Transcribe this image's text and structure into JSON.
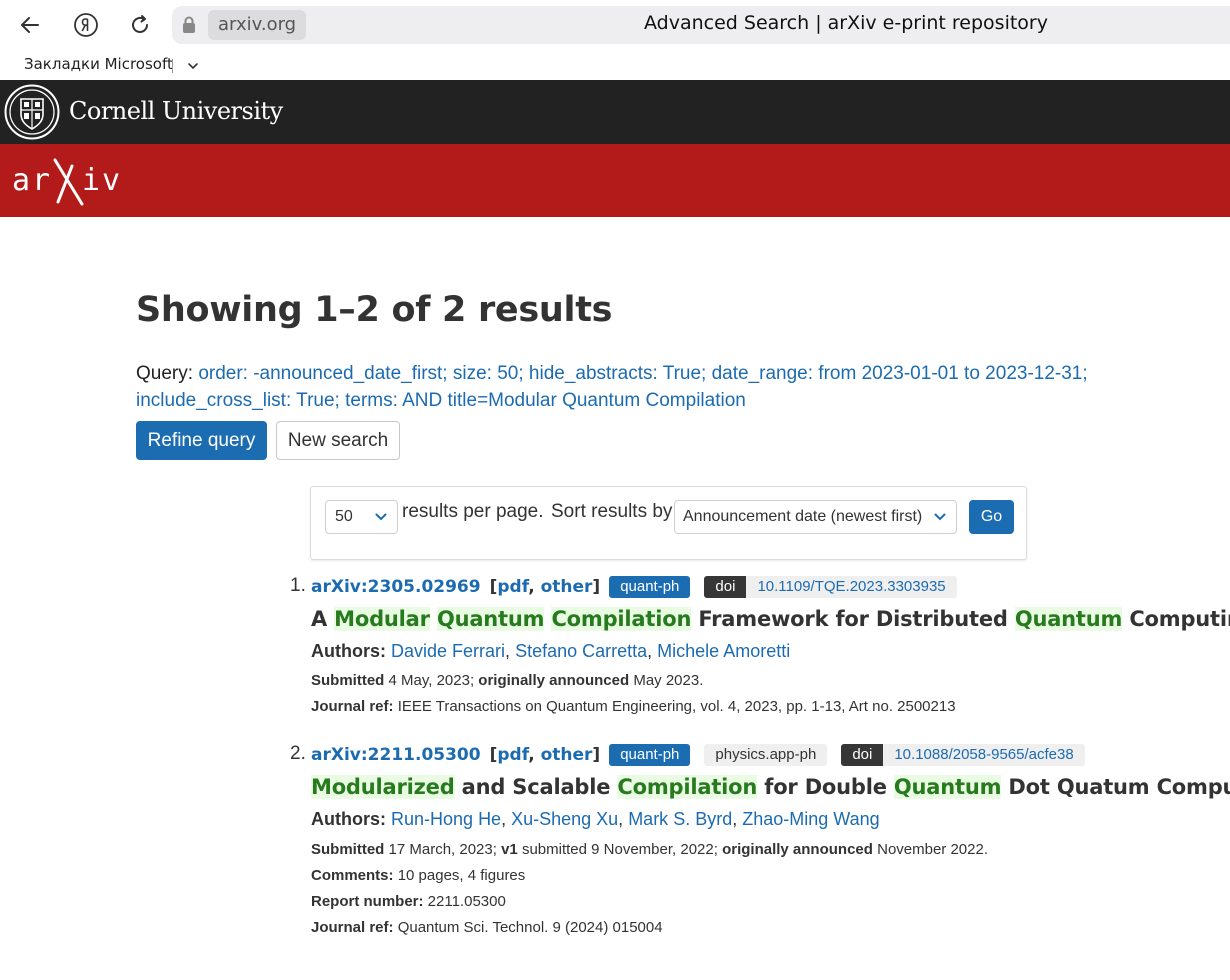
{
  "browser": {
    "domain": "arxiv.org",
    "tab_title": "Advanced Search | arXiv e-print repository",
    "bookmark": "Закладки Microsoft"
  },
  "cornell": {
    "name": "Cornell University"
  },
  "arxiv": {
    "logo_text": "arXiv"
  },
  "results": {
    "heading": "Showing 1–2 of 2 results",
    "query_label": "Query:",
    "query_value": "order: -announced_date_first; size: 50; hide_abstracts: True; date_range: from 2023-01-01 to 2023-12-31; include_cross_list: True; terms: AND title=Modular Quantum Compilation"
  },
  "buttons": {
    "refine": "Refine query",
    "new_search": "New search",
    "go": "Go"
  },
  "controls": {
    "size_value": "50",
    "per_page_label": "results per page.",
    "sort_label": "Sort results by",
    "sort_value": "Announcement date (newest first)"
  },
  "items": [
    {
      "index": "1.",
      "id": "arXiv:2305.02969",
      "links_open": "[",
      "pdf": "pdf",
      "comma": ", ",
      "other": "other",
      "links_close": "]",
      "primary_tag": "quant-ph",
      "doi_label": "doi",
      "doi": "10.1109/TQE.2023.3303935",
      "title_parts": [
        "A ",
        "Modular",
        " ",
        "Quantum",
        " ",
        "Compilation",
        " Framework for Distributed ",
        "Quantum",
        " Computing"
      ],
      "authors_label": "Authors:",
      "authors": [
        "Davide Ferrari",
        "Stefano Carretta",
        "Michele Amoretti"
      ],
      "submitted_label": "Submitted",
      "submitted": "4 May, 2023;",
      "announced_label": "originally announced",
      "announced": "May 2023.",
      "journal_label": "Journal ref:",
      "journal": "IEEE Transactions on Quantum Engineering, vol. 4, 2023, pp. 1-13, Art no. 2500213"
    },
    {
      "index": "2.",
      "id": "arXiv:2211.05300",
      "links_open": "[",
      "pdf": "pdf",
      "comma": ", ",
      "other": "other",
      "links_close": "]",
      "primary_tag": "quant-ph",
      "secondary_tag": "physics.app-ph",
      "doi_label": "doi",
      "doi": "10.1088/2058-9565/acfe38",
      "title_parts": [
        "Modularized",
        " and Scalable ",
        "Compilation",
        " for Double ",
        "Quantum",
        " Dot Quatum Computing"
      ],
      "authors_label": "Authors:",
      "authors": [
        "Run-Hong He",
        "Xu-Sheng Xu",
        "Mark S. Byrd",
        "Zhao-Ming Wang"
      ],
      "submitted_label": "Submitted",
      "submitted": "17 March, 2023;",
      "v1_label": "v1",
      "v1": "submitted 9 November, 2022;",
      "announced_label": "originally announced",
      "announced": "November 2022.",
      "comments_label": "Comments:",
      "comments": "10 pages, 4 figures",
      "report_label": "Report number:",
      "report": "2211.05300",
      "journal_label": "Journal ref:",
      "journal": "Quantum Sci. Technol. 9 (2024) 015004"
    }
  ],
  "colors": {
    "arxiv_red": "#b31b1b",
    "cornell_dark": "#222222",
    "link_blue": "#1c6bb0",
    "highlight_green": "#277a1d"
  }
}
